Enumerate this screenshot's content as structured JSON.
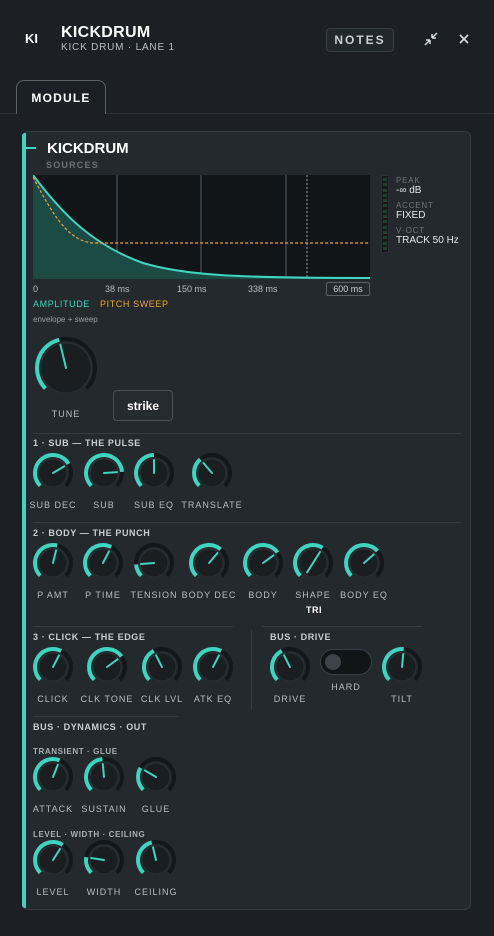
{
  "header": {
    "badge": "KI",
    "title": "KICKDRUM",
    "subtitle": "KICK DRUM · LANE 1",
    "notes_label": "NOTES"
  },
  "tabs": [
    {
      "label": "MODULE",
      "active": true
    }
  ],
  "module": {
    "title": "KICKDRUM",
    "sources_label": "SOURCES",
    "graph": {
      "x_ticks": [
        "0",
        "38 ms",
        "150 ms",
        "338 ms"
      ],
      "x_max_label": "600 ms",
      "legend_amp": "AMPLITUDE",
      "legend_pitch": "PITCH SWEEP",
      "caption": "envelope + sweep"
    },
    "readouts": {
      "peak_label": "PEAK",
      "peak_value": "-∞ dB",
      "accent_label": "ACCENT",
      "accent_value": "FIXED",
      "voct_label": "V·OCT",
      "voct_value": "TRACK 50 Hz"
    },
    "tune_label": "TUNE",
    "strike_label": "strike",
    "sections": {
      "sub": "1 · SUB — THE PULSE",
      "body": "2 · BODY — THE PUNCH",
      "click": "3 · CLICK — THE EDGE",
      "bus_drive": "BUS · DRIVE",
      "bus_out": "BUS · DYNAMICS · OUT",
      "transient": "TRANSIENT · GLUE",
      "level": "LEVEL · WIDTH · CEILING"
    },
    "knobs": {
      "sub_dec": "SUB DEC",
      "sub": "SUB",
      "sub_eq": "SUB EQ",
      "translate": "TRANSLATE",
      "p_amt": "P AMT",
      "p_time": "P TIME",
      "tension": "TENSION",
      "body_dec": "BODY DEC",
      "body": "BODY",
      "shape": "SHAPE",
      "body_eq": "BODY EQ",
      "click": "CLICK",
      "clk_tone": "CLK TONE",
      "clk_lvl": "CLK LVL",
      "atk_eq": "ATK EQ",
      "drive": "DRIVE",
      "hard": "HARD",
      "tilt": "TILT",
      "attack": "ATTACK",
      "sustain": "SUSTAIN",
      "glue": "GLUE",
      "level": "LEVEL",
      "width": "WIDTH",
      "ceiling": "CEILING"
    },
    "shape_value": "TRI"
  },
  "colors": {
    "accent": "#3fd4c0",
    "pitch": "#f0a535",
    "panel": "#24292d",
    "bg": "#1c2024"
  }
}
